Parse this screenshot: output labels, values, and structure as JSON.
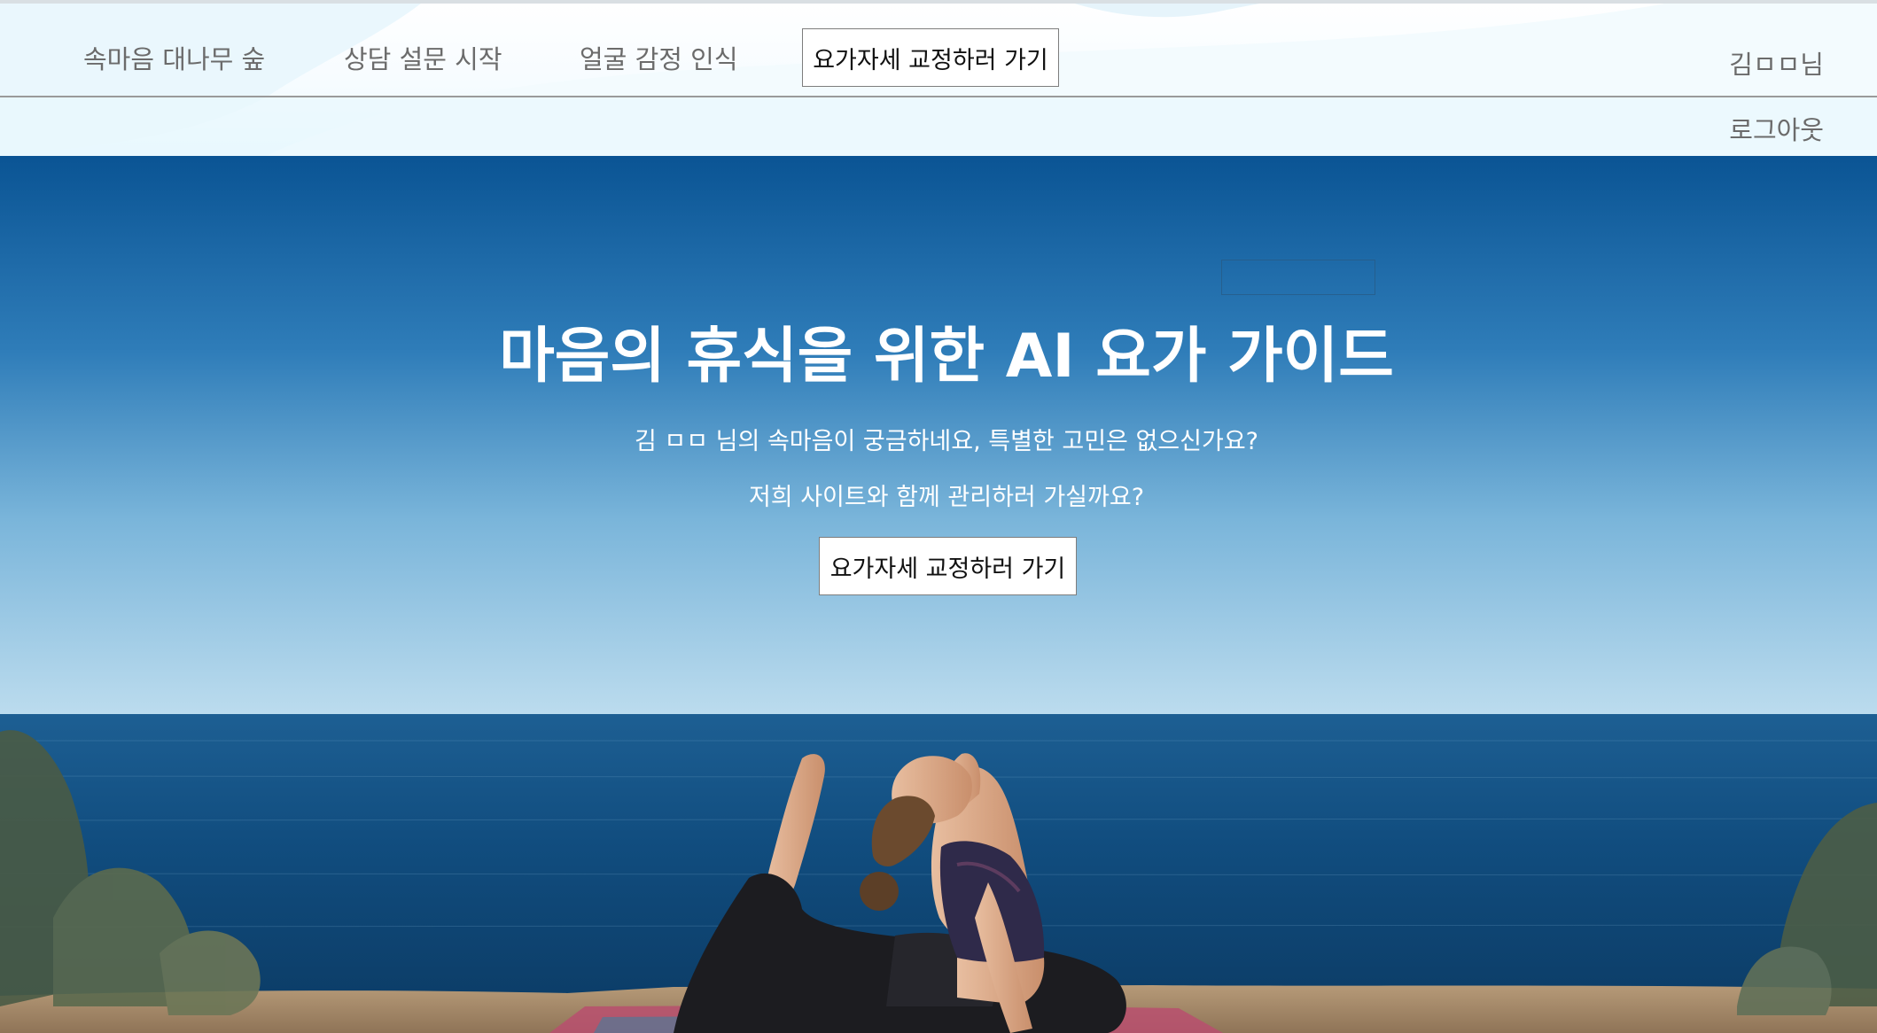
{
  "header": {
    "nav": [
      {
        "label": "속마음 대나무 숲"
      },
      {
        "label": "상담 설문 시작"
      },
      {
        "label": "얼굴 감정 인식"
      }
    ],
    "cta_label": "요가자세 교정하러 가기",
    "user_name": "김ㅁㅁ님",
    "logout_label": "로그아웃"
  },
  "hero": {
    "title": "마음의 휴식을 위한 AI 요가 가이드",
    "subtitle_1": "김 ㅁㅁ 님의 속마음이 궁금하네요, 특별한 고민은 없으신가요?",
    "subtitle_2": "저희 사이트와 함께 관리하러 가실까요?",
    "cta_label": "요가자세 교정하러 가기"
  },
  "colors": {
    "nav_text": "#6b6b6b",
    "sky_top": "#0c5a98",
    "sky_horizon": "#b4d6ea",
    "sea": "#0f4675",
    "hero_text": "#ffffff"
  }
}
